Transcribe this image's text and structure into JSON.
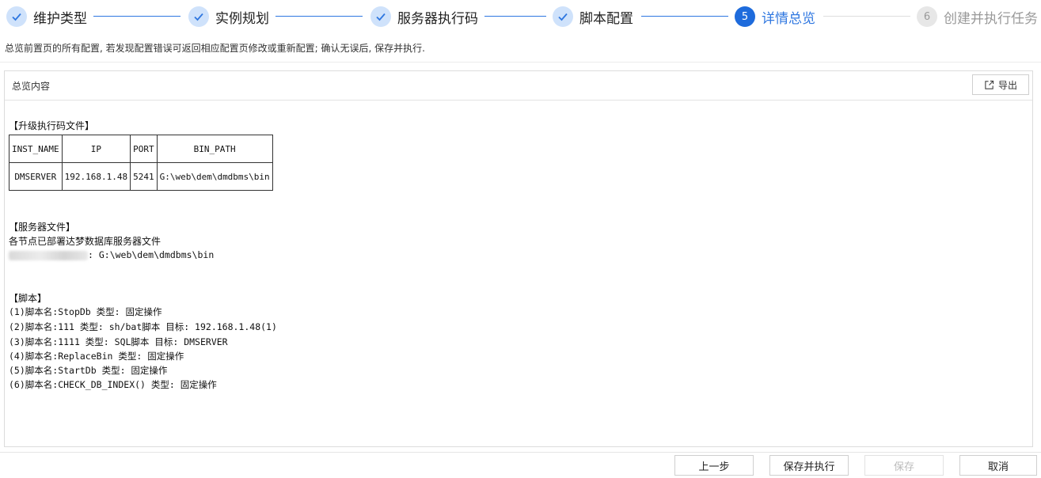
{
  "steps": [
    {
      "label": "维护类型",
      "state": "done"
    },
    {
      "label": "实例规划",
      "state": "done"
    },
    {
      "label": "服务器执行码",
      "state": "done"
    },
    {
      "label": "脚本配置",
      "state": "done"
    },
    {
      "label": "详情总览",
      "state": "active",
      "number": "5"
    },
    {
      "label": "创建并执行任务",
      "state": "pending",
      "number": "6"
    }
  ],
  "hint": "总览前置页的所有配置, 若发现配置错误可返回相应配置页修改或重新配置; 确认无误后, 保存并执行.",
  "panel": {
    "title": "总览内容",
    "export_label": "导出"
  },
  "upgrade_section": {
    "title": "【升级执行码文件】",
    "columns": [
      "INST_NAME",
      "IP",
      "PORT",
      "BIN_PATH"
    ],
    "rows": [
      [
        "DMSERVER",
        "192.168.1.48",
        "5241",
        "G:\\web\\dem\\dmdbms\\bin"
      ]
    ]
  },
  "server_section": {
    "title": "【服务器文件】",
    "line1": "各节点已部署达梦数据库服务器文件",
    "path_line": ": G:\\web\\dem\\dmdbms\\bin"
  },
  "script_section": {
    "title": "【脚本】",
    "items": [
      "(1)脚本名:StopDb 类型: 固定操作",
      "(2)脚本名:111 类型: sh/bat脚本 目标: 192.168.1.48(1)",
      "(3)脚本名:1111 类型: SQL脚本 目标: DMSERVER",
      "(4)脚本名:ReplaceBin 类型: 固定操作",
      "(5)脚本名:StartDb 类型: 固定操作",
      "(6)脚本名:CHECK_DB_INDEX() 类型: 固定操作"
    ]
  },
  "footer": {
    "prev": "上一步",
    "save_execute": "保存并执行",
    "save": "保存",
    "cancel": "取消"
  },
  "colors": {
    "accent": "#1e6bdc",
    "done_circle": "#cfe2fb",
    "pending_circle": "#e7e7e7"
  }
}
